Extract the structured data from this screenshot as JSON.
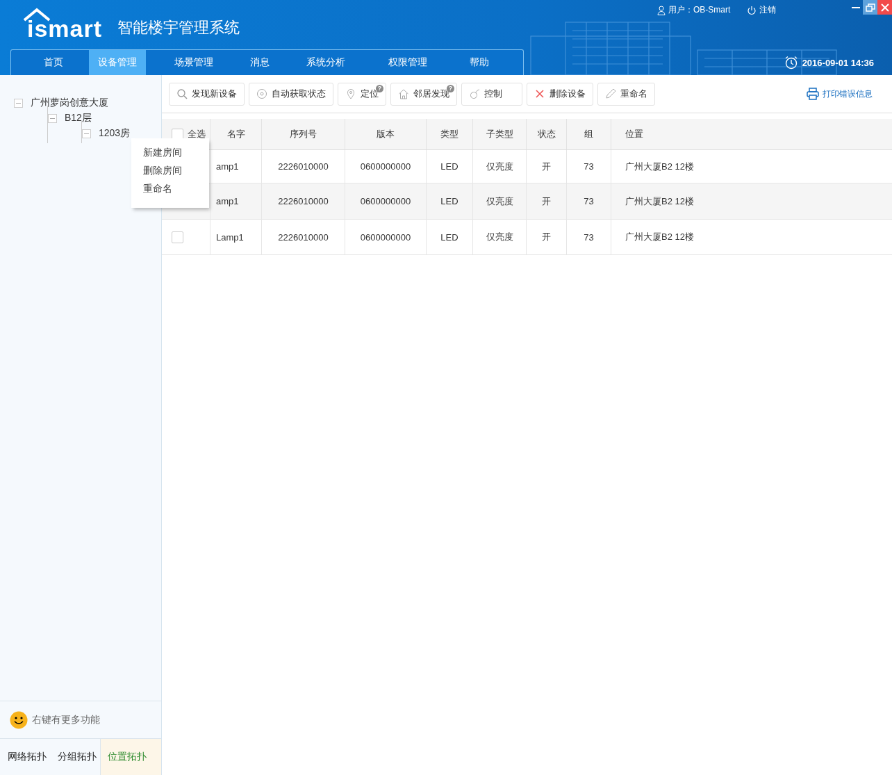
{
  "header": {
    "logo": "ismart",
    "title": "智能楼宇管理系统",
    "user": "用户：OB-Smart",
    "logout": "注销",
    "datetime": "2016-09-01  14:36"
  },
  "nav": [
    {
      "label": "首页",
      "selected": false
    },
    {
      "label": "设备管理",
      "selected": true
    },
    {
      "label": "场景管理",
      "selected": false
    },
    {
      "label": "消息",
      "selected": false
    },
    {
      "label": "系统分析",
      "selected": false
    },
    {
      "label": "权限管理",
      "selected": false
    },
    {
      "label": "帮助",
      "selected": false
    }
  ],
  "tree": [
    {
      "label": "广州萝岗创意大厦",
      "expanded": true,
      "children": [
        {
          "label": "B12层",
          "expanded": true,
          "children": [
            {
              "label": "1203房",
              "expanded": true
            }
          ]
        }
      ]
    }
  ],
  "context_menu": [
    "新建房间",
    "删除房间",
    "重命名"
  ],
  "hint": "右键有更多功能",
  "bottom_tabs": [
    {
      "label": "网络拓扑",
      "selected": false
    },
    {
      "label": "分组拓扑",
      "selected": false
    },
    {
      "label": "位置拓扑",
      "selected": true
    }
  ],
  "toolbar": [
    {
      "kind": "search",
      "label": "发现新设备",
      "help": false
    },
    {
      "kind": "auto",
      "label": "自动获取状态",
      "help": false
    },
    {
      "kind": "pin",
      "label": "定位",
      "help": "?"
    },
    {
      "kind": "home",
      "label": "邻居发现",
      "help": "?"
    },
    {
      "kind": "mouse",
      "label": "控制",
      "help": false
    },
    {
      "kind": "delete",
      "label": "删除设备",
      "help": false
    },
    {
      "kind": "pencil",
      "label": "重命名",
      "help": false
    }
  ],
  "print_link": "打印错误信息",
  "table": {
    "select_all": {
      "label": "全选",
      "checked": false
    },
    "columns": [
      "名字",
      "序列号",
      "版本",
      "类型",
      "子类型",
      "状态",
      "组",
      "位置"
    ],
    "rows": [
      {
        "cells": [
          "amp1",
          "2226010000",
          "0600000000",
          "LED",
          "仅亮度",
          "开",
          "73",
          "广州大厦B2 12楼"
        ]
      },
      {
        "cells": [
          "amp1",
          "2226010000",
          "0600000000",
          "LED",
          "仅亮度",
          "开",
          "73",
          "广州大厦B2 12楼"
        ]
      },
      {
        "checked": false,
        "cells": [
          "Lamp1",
          "2226010000",
          "0600000000",
          "LED",
          "仅亮度",
          "开",
          "73",
          "广州大厦B2 12楼"
        ]
      }
    ]
  }
}
